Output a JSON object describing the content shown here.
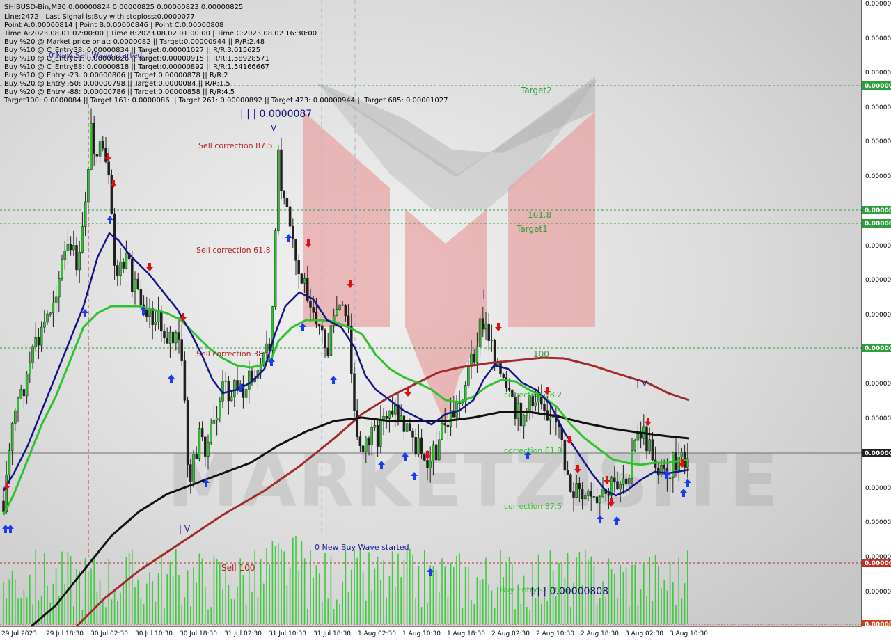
{
  "header": {
    "lines": [
      "SHIBUSD-Bin,M30  0.00000824 0.00000825 0.00000823 0.00000825",
      "Line:2472 | Last Signal is:Buy with stoploss:0.0000077",
      "Point A:0.00000814 | Point B:0.00000846 | Point C:0.00000808",
      "Time A:2023.08.01 02:00:00 | Time B:2023.08.02 01:00:00 | Time C:2023.08.02 16:30:00",
      "Buy %20 @ Market price or at: 0.0000082 || Target:0.00000944 || R/R:2.48",
      "Buy %10 @ C_Entry38: 0.00000834 || Target:0.00001027 || R/R:3.015625",
      "Buy %10 @ C_Entry61: 0.00000826 || Target:0.00000915 || R/R:1.58928571",
      "Buy %10 @ C_Entry88: 0.00000818 || Target:0.00000892 || R/R:1.54166667",
      "Buy %10 @ Entry -23: 0.00000806 || Target:0.00000878 || R/R:2",
      "Buy %20 @ Entry -50: 0.00000798 || Target:0.0000084 || R/R:1.5",
      "Buy %20 @ Entry -88: 0.00000786 || Target:0.00000858 || R/R:4.5",
      "Target100: 0.0000084 || Target 161: 0.0000086 || Target 261: 0.00000892 || Target 423: 0.00000944 || Target 685: 0.00001027"
    ]
  },
  "annotations": {
    "new_sell_wave": "0 New Sell Wave started",
    "new_buy_wave": "0 New Buy Wave started",
    "price_top": "| | | 0.0000087",
    "price_bottom": "| | | 0.00000808",
    "sell_corr_875": "Sell correction 87.5",
    "sell_corr_618": "Sell correction 61.8",
    "sell_corr_382": "Sell correction 38.2",
    "sell_100": "Sell 100",
    "target2": "Target2",
    "fib_1618": "161.8",
    "target1": "Target1",
    "level_100": "100",
    "correction_382": "correction 38.2",
    "correction_618": "correction 61.8",
    "correction_875": "correction 87.5",
    "buy_entry": "Buy Entry -23.6",
    "watermark": "MARKETZISITE",
    "wave_mark_top": "V",
    "wave_mark_low": "| V",
    "wave_mark_mid": "|",
    "wave_mark_right": "| V"
  },
  "price_axis": {
    "labels": [
      "0.00000",
      "0.00000",
      "0.00000",
      "0.00000",
      "0.00000",
      "0.00000",
      "0.00000",
      "0.00000",
      "0.00000",
      "0.00000",
      "0.00000",
      "0.00000",
      "0.00000",
      "0.00000",
      "0.00000",
      "0.00000",
      "0.00000",
      "0.00000",
      "0.00000"
    ],
    "tags": [
      {
        "text": "0.00000",
        "color": "#2e9e3e"
      },
      {
        "text": "0.00000",
        "color": "#2e9e3e"
      },
      {
        "text": "0.00000",
        "color": "#2e9e3e"
      },
      {
        "text": "0.00000",
        "color": "#2e9e3e"
      },
      {
        "text": "0.00000",
        "color": "#202020"
      },
      {
        "text": "0.00000",
        "color": "#c0302a"
      },
      {
        "text": "0.00000",
        "color": "#d0401a"
      }
    ]
  },
  "colors": {
    "green_level": "#2e9e3e",
    "red_level": "#b03030",
    "ma_fast": "#13138a",
    "ma_mid": "#2ec22e",
    "ma_slow": "#101010",
    "ma_long": "#a02a2a",
    "buy_arrow": "#1a3cf0",
    "sell_arrow": "#e01010",
    "volume": "#3ec93e"
  },
  "chart_data": {
    "type": "candlestick",
    "symbol": "SHIBUSD-Bin",
    "timeframe": "M30",
    "x_tick_labels": [
      "29 Jul 2023",
      "29 Jul 18:30",
      "30 Jul 02:30",
      "30 Jul 10:30",
      "30 Jul 18:30",
      "31 Jul 02:30",
      "31 Jul 10:30",
      "31 Jul 18:30",
      "1 Aug 02:30",
      "1 Aug 10:30",
      "1 Aug 18:30",
      "2 Aug 02:30",
      "2 Aug 10:30",
      "2 Aug 18:30",
      "3 Aug 02:30",
      "3 Aug 10:30"
    ],
    "ylim": [
      7.74e-06,
      8.955e-06
    ],
    "levels": [
      {
        "name": "Target2",
        "value": 9.44e-06,
        "color": "#2e9e3e"
      },
      {
        "name": "161.8",
        "value": 8.6e-06,
        "color": "#2e9e3e"
      },
      {
        "name": "Target1",
        "value": 8.6e-06,
        "color": "#2e9e3e"
      },
      {
        "name": "100",
        "value": 8.4e-06,
        "color": "#2e9e3e"
      },
      {
        "name": "Sell 100",
        "value": 7.8e-06,
        "color": "#b03030"
      }
    ],
    "current_price": 8.25e-06,
    "grid": true
  }
}
